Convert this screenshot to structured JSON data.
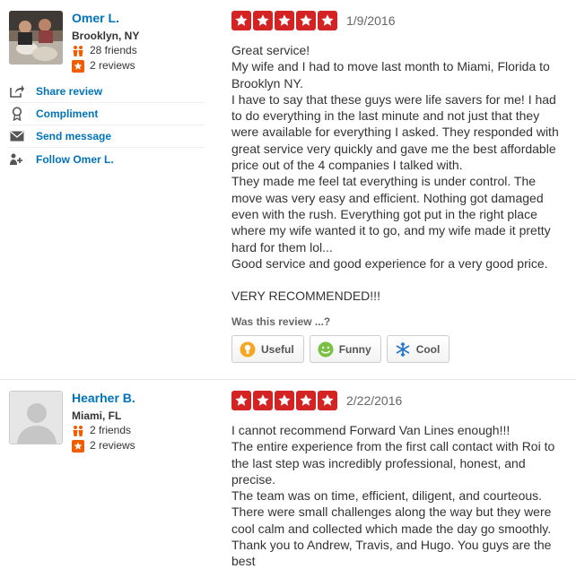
{
  "reviews": [
    {
      "user": {
        "name": "Omer L.",
        "location": "Brooklyn, NY",
        "friends": "28 friends",
        "reviews": "2 reviews"
      },
      "actions": {
        "share": "Share review",
        "compliment": "Compliment",
        "message": "Send message",
        "follow": "Follow Omer L."
      },
      "rating": 5,
      "date": "1/9/2016",
      "text": "Great service!\nMy wife and I had to move last month to Miami, Florida to Brooklyn NY.\nI have to say that these guys were life savers for me! I had to do everything in the last minute and not just that they were available for everything I asked. They responded with great service very quickly and gave me the best affordable price out of the 4 companies I talked with.\nThey made me feel tat everything is under control. The move was very easy and efficient. Nothing got damaged even with the rush. Everything got put in the right place where my wife wanted it to go, and my wife made it pretty hard for them lol...\nGood service and good experience for a very good price.\n\nVERY RECOMMENDED!!!",
      "helpful_prompt": "Was this review ...?",
      "votes": {
        "useful": "Useful",
        "funny": "Funny",
        "cool": "Cool"
      }
    },
    {
      "user": {
        "name": "Hearher B.",
        "location": "Miami, FL",
        "friends": "2 friends",
        "reviews": "2 reviews"
      },
      "rating": 5,
      "date": "2/22/2016",
      "text": "I cannot recommend Forward Van Lines enough!!!\nThe entire experience from the first call contact with Roi to the last step was incredibly professional, honest, and precise.\nThe team was on time, efficient, diligent, and courteous.\n There were small challenges along the way but they were cool calm and collected which made the day go smoothly.\nThank you to Andrew, Travis, and Hugo.  You guys are the best"
    }
  ],
  "colors": {
    "star": "#d32323",
    "link": "#0073bb",
    "friends_icon": "#f15c00",
    "reviews_icon": "#f15c00"
  },
  "icons": [
    "share-icon",
    "compliment-icon",
    "message-icon",
    "follow-icon",
    "useful-icon",
    "funny-icon",
    "cool-icon",
    "friends-icon",
    "reviews-icon",
    "star-icon"
  ]
}
